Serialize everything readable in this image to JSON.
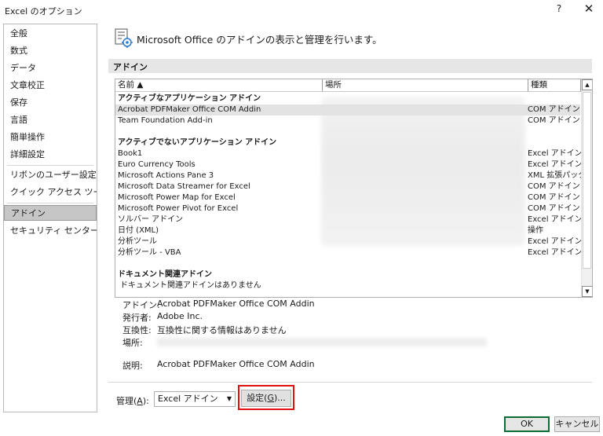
{
  "window": {
    "title": "Excel のオプション",
    "help_label": "?",
    "close_label": "✕"
  },
  "sidebar": {
    "items": [
      {
        "label": "全般"
      },
      {
        "label": "数式"
      },
      {
        "label": "データ"
      },
      {
        "label": "文章校正"
      },
      {
        "label": "保存"
      },
      {
        "label": "言語"
      },
      {
        "label": "簡単操作"
      },
      {
        "label": "詳細設定"
      },
      {
        "label": "リボンのユーザー設定"
      },
      {
        "label": "クイック アクセス ツール バー"
      },
      {
        "label": "アドイン"
      },
      {
        "label": "セキュリティ センター"
      }
    ],
    "active": "アドイン"
  },
  "header": {
    "text": "Microsoft Office のアドインの表示と管理を行います。",
    "icon": "addin-gear-icon"
  },
  "section": {
    "title": "アドイン"
  },
  "addin_list": {
    "columns": {
      "name": "名前 ▲",
      "location": "場所",
      "type": "種類"
    },
    "groups": [
      {
        "title": "アクティブなアプリケーション アドイン",
        "rows": [
          {
            "name": "Acrobat PDFMaker Office COM Addin",
            "type": "COM アドイン",
            "selected": true
          },
          {
            "name": "Team Foundation Add-in",
            "type": "COM アドイン"
          }
        ]
      },
      {
        "title": "アクティブでないアプリケーション アドイン",
        "rows": [
          {
            "name": "Book1",
            "type": "Excel アドイン"
          },
          {
            "name": "Euro Currency Tools",
            "type": "Excel アドイン"
          },
          {
            "name": "Microsoft Actions Pane 3",
            "type": "XML 拡張パック"
          },
          {
            "name": "Microsoft Data Streamer for Excel",
            "type": "COM アドイン"
          },
          {
            "name": "Microsoft Power Map for Excel",
            "type": "COM アドイン"
          },
          {
            "name": "Microsoft Power Pivot for Excel",
            "type": "COM アドイン"
          },
          {
            "name": "ソルバー アドイン",
            "type": "Excel アドイン"
          },
          {
            "name": "日付 (XML)",
            "type": "操作"
          },
          {
            "name": "分析ツール",
            "type": "Excel アドイン"
          },
          {
            "name": "分析ツール - VBA",
            "type": "Excel アドイン"
          }
        ]
      },
      {
        "title": "ドキュメント関連アドイン",
        "note": "ドキュメント関連アドインはありません"
      }
    ]
  },
  "details": {
    "addin_label": "アドイン:",
    "addin_value": "Acrobat PDFMaker Office COM Addin",
    "publisher_label": "発行者:",
    "publisher_value": "Adobe Inc.",
    "compat_label": "互換性:",
    "compat_value": "互換性に関する情報はありません",
    "location_label": "場所:",
    "desc_label": "説明:",
    "desc_value": "Acrobat PDFMaker Office COM Addin"
  },
  "manage": {
    "label_prefix": "管理(",
    "label_key": "A",
    "label_suffix": "):",
    "selected": "Excel アドイン",
    "go_prefix": "設定(",
    "go_key": "G",
    "go_suffix": ")..."
  },
  "footer": {
    "ok": "OK",
    "cancel": "キャンセル"
  },
  "colors": {
    "highlight_frame": "#e31010",
    "ok_border": "#0e6b34",
    "active_item": "#c6c6c6"
  }
}
